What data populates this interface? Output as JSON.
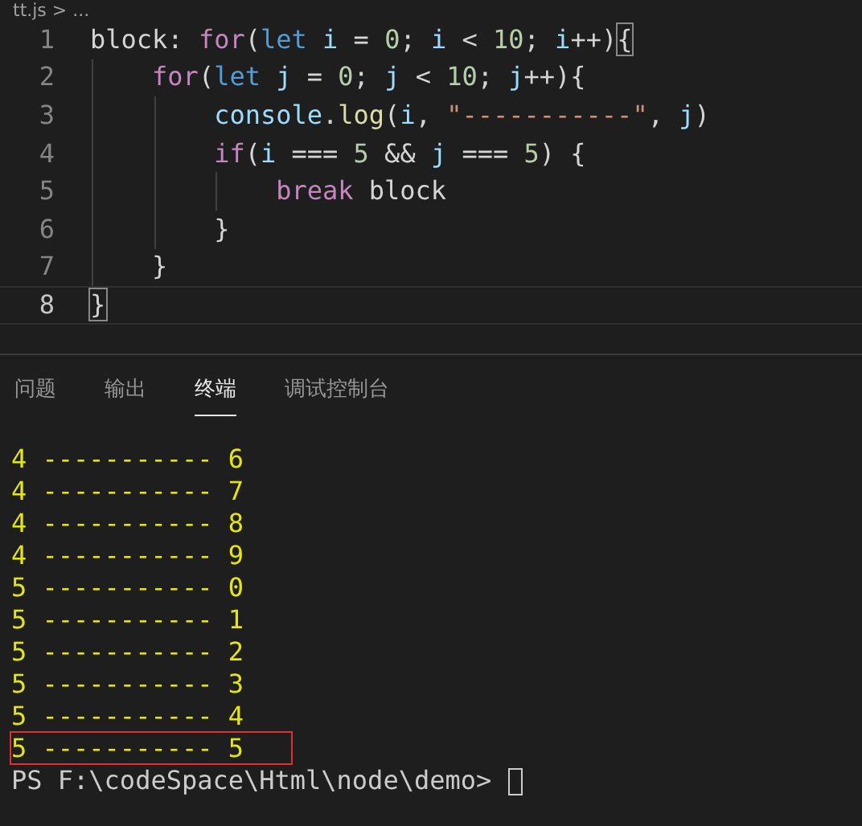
{
  "breadcrumb": "tt.js > ...",
  "editor": {
    "lines": [
      {
        "number": "1",
        "current": false,
        "tokens": [
          {
            "text": "block: ",
            "kind": "plain"
          },
          {
            "text": "for",
            "kind": "keyword"
          },
          {
            "text": "(",
            "kind": "plain"
          },
          {
            "text": "let",
            "kind": "storage"
          },
          {
            "text": " i",
            "kind": "variable"
          },
          {
            "text": " = ",
            "kind": "plain"
          },
          {
            "text": "0",
            "kind": "number"
          },
          {
            "text": "; ",
            "kind": "plain"
          },
          {
            "text": "i",
            "kind": "variable"
          },
          {
            "text": " < ",
            "kind": "plain"
          },
          {
            "text": "10",
            "kind": "number"
          },
          {
            "text": "; ",
            "kind": "plain"
          },
          {
            "text": "i",
            "kind": "variable"
          },
          {
            "text": "++)",
            "kind": "plain"
          },
          {
            "text": "{",
            "kind": "bracket-match"
          }
        ]
      },
      {
        "number": "2",
        "current": false,
        "tokens": [
          {
            "text": "    for",
            "kind": "keyword"
          },
          {
            "text": "(",
            "kind": "plain"
          },
          {
            "text": "let",
            "kind": "storage"
          },
          {
            "text": " j",
            "kind": "variable"
          },
          {
            "text": " = ",
            "kind": "plain"
          },
          {
            "text": "0",
            "kind": "number"
          },
          {
            "text": "; ",
            "kind": "plain"
          },
          {
            "text": "j",
            "kind": "variable"
          },
          {
            "text": " < ",
            "kind": "plain"
          },
          {
            "text": "10",
            "kind": "number"
          },
          {
            "text": "; ",
            "kind": "plain"
          },
          {
            "text": "j",
            "kind": "variable"
          },
          {
            "text": "++){",
            "kind": "plain"
          }
        ]
      },
      {
        "number": "3",
        "current": false,
        "tokens": [
          {
            "text": "        console",
            "kind": "variable"
          },
          {
            "text": ".",
            "kind": "plain"
          },
          {
            "text": "log",
            "kind": "function"
          },
          {
            "text": "(",
            "kind": "plain"
          },
          {
            "text": "i",
            "kind": "variable"
          },
          {
            "text": ", ",
            "kind": "plain"
          },
          {
            "text": "\"-----------\"",
            "kind": "string"
          },
          {
            "text": ", ",
            "kind": "plain"
          },
          {
            "text": "j",
            "kind": "variable"
          },
          {
            "text": ")",
            "kind": "plain"
          }
        ]
      },
      {
        "number": "4",
        "current": false,
        "tokens": [
          {
            "text": "        if",
            "kind": "keyword"
          },
          {
            "text": "(",
            "kind": "plain"
          },
          {
            "text": "i",
            "kind": "variable"
          },
          {
            "text": " === ",
            "kind": "plain"
          },
          {
            "text": "5",
            "kind": "number"
          },
          {
            "text": " && ",
            "kind": "plain"
          },
          {
            "text": "j",
            "kind": "variable"
          },
          {
            "text": " === ",
            "kind": "plain"
          },
          {
            "text": "5",
            "kind": "number"
          },
          {
            "text": ") {",
            "kind": "plain"
          }
        ]
      },
      {
        "number": "5",
        "current": false,
        "tokens": [
          {
            "text": "            break",
            "kind": "keyword"
          },
          {
            "text": " block",
            "kind": "plain"
          }
        ]
      },
      {
        "number": "6",
        "current": false,
        "tokens": [
          {
            "text": "        }",
            "kind": "plain"
          }
        ]
      },
      {
        "number": "7",
        "current": false,
        "tokens": [
          {
            "text": "    }",
            "kind": "plain"
          }
        ]
      },
      {
        "number": "8",
        "current": true,
        "tokens": [
          {
            "text": "}",
            "kind": "bracket-match"
          }
        ]
      }
    ]
  },
  "panel": {
    "tabs": [
      {
        "label": "问题",
        "selected": false
      },
      {
        "label": "输出",
        "selected": false
      },
      {
        "label": "终端",
        "selected": true
      },
      {
        "label": "调试控制台",
        "selected": false
      }
    ],
    "terminal": {
      "lines": [
        {
          "text": "4 ----------- 6",
          "highlighted": false
        },
        {
          "text": "4 ----------- 7",
          "highlighted": false
        },
        {
          "text": "4 ----------- 8",
          "highlighted": false
        },
        {
          "text": "4 ----------- 9",
          "highlighted": false
        },
        {
          "text": "5 ----------- 0",
          "highlighted": false
        },
        {
          "text": "5 ----------- 1",
          "highlighted": false
        },
        {
          "text": "5 ----------- 2",
          "highlighted": false
        },
        {
          "text": "5 ----------- 3",
          "highlighted": false
        },
        {
          "text": "5 ----------- 4",
          "highlighted": false
        },
        {
          "text": "5 ----------- 5",
          "highlighted": true
        }
      ],
      "prompt": "PS F:\\codeSpace\\Html\\node\\demo>"
    }
  }
}
